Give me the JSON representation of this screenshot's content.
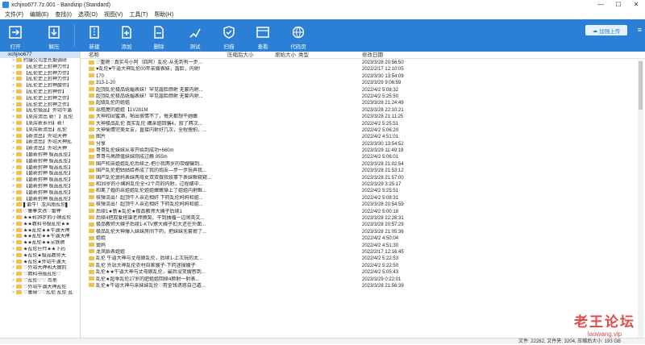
{
  "window": {
    "title": "xchjno677.7z.001 - Bandizip (Standard)",
    "controls": [
      "—",
      "☐",
      "✕"
    ]
  },
  "menu": [
    "文件(F)",
    "编辑(E)",
    "查找(I)",
    "选项(O)",
    "视图(V)",
    "工具(T)",
    "帮助(H)"
  ],
  "toolbar": {
    "open": "打开",
    "extract": "解压",
    "new": "新建",
    "add": "添加",
    "delete": "删除",
    "test": "测试",
    "scan": "扫描",
    "view": "查看",
    "codepage": "代码页",
    "download": "加强上传",
    "accent": "#2b7fd4"
  },
  "tree": {
    "root": "xchjno677",
    "items": [
      "约操公司里长期调研",
      "【乱伦史上封神力作】",
      "【乱伦史上封神力作】",
      "【乱伦史上封神力作】",
      "【乱伦史上封神酸作】",
      "【乱伦史上封神作】",
      "【乱伦史上封神之作】",
      "【乱伦史上封神之作】",
      "【乱伦极品】外站牛逼",
      "【某房流出 新！】乱伦",
      "【某房新系列】新！",
      "【某房新流出】乱伦",
      "【新流出】外站大神",
      "【新流出】外站大神乱",
      "【新流出】外站大神",
      "【最新封神 极品乱伦】",
      "【最新封神 极品乱伦】",
      "【最新封神 极品乱伦】",
      "【最新封神 极品乱伦】",
      "【最新封神 极品乱伦】",
      "【最新封神 极品乱伦】",
      "【最新封神 极品乱伦】",
      "【最新封神 极品乱伦】",
      "▌最牛！龙凤胎乱伦▌",
      "♡重拳女孩♡雷神",
      "★★和39岁的小姨乱伦",
      "★★教科书极乱伦★★",
      "★★乱伦★★牛逼大神",
      "★★乱伦★★牛逼大神",
      "★★乱伦★★宗族牌",
      "★乱伦巨作★★下药",
      "★乱伦★极品教师大",
      "★乱伦★外站牛逼大",
      "♡外站大神和大嫂的",
      "♡教科书级乱伦♡",
      "♡乱伦♡♡ 与亲",
      "♡外站牛逼大神乱伦",
      "♡重磅♡♡乱伦 乱伦 乱"
    ]
  },
  "columns": {
    "name": "名称",
    "compressed": "压缩后大小",
    "original": "原始大小",
    "type": "类型",
    "modified": "修改日期"
  },
  "files": [
    {
      "name": "♡重磅♡真实与小阿（四阿）乱伦-从无到有一步...",
      "date": "2023/3/28 20:56:50"
    },
    {
      "name": "♥乱伦♥牛逼大神乱伦00年亲嫂表妹，露脸，内射!",
      "date": "2022/2/17 12:10:05"
    },
    {
      "name": "170",
      "date": "2023/3/30 13:54:09"
    },
    {
      "name": "313-1-20",
      "date": "2023/3/29 9:06:59"
    },
    {
      "name": "超顶乱伦极品妩媚表妹！罕见露脸颜射 无套内射...",
      "date": "2022/4/2 5:08:32"
    },
    {
      "name": "超顶乱伦极品妩媚表妹！罕见露脸颜射 无套内射...",
      "date": "2022/4/2 5:25:50"
    },
    {
      "name": "超级乱伦的姐姐",
      "date": "2023/3/28 21:24:49"
    },
    {
      "name": "出租屋的姐姐【1V281M",
      "date": "2023/3/28 22:10:21"
    },
    {
      "name": "大神和闺蜜酒，啪出很情不了，每天都想干她嫩",
      "date": "2023/3/28 21:11:25"
    },
    {
      "name": "大神极品乱伦 真实乱伦 媾亲姐回骗4，寂了两次...",
      "date": "2022/4/2 5:25:51"
    },
    {
      "name": "大神偷情完美女友，直接内射好几次，全程撸拍，...",
      "date": "2022/4/2 5:06:20"
    },
    {
      "name": "图片",
      "date": "2022/4/2 4:51:01"
    },
    {
      "name": "分享",
      "date": "2023/3/30 13:54:52"
    },
    {
      "name": "哥哥乱伦妹妹从零开始到成功+660m",
      "date": "2023/3/29 11:49:19"
    },
    {
      "name": "哥哥与高颜值妹妹刚成过瘾 955m",
      "date": "2022/4/2 5:06:01"
    },
    {
      "name": "国产和亲姐姐乱伦后续之-把小我两岁的带嫂骗到...",
      "date": "2023/3/28 21:02:54"
    },
    {
      "name": "国产乱伦把姑姑给养成了我的炮友—步一步玩弄我...",
      "date": "2023/3/28 21:53:12"
    },
    {
      "name": "国产乱伦舅妈表妹两母女双双做我奴事下表妹瞬窥窥...",
      "date": "2023/3/28 21:57:00"
    },
    {
      "name": "和39岁的小姨妈乱伦全+2个月的内射，过程细中...",
      "date": "2023/3/29 3:25:17"
    },
    {
      "name": "和离了婚的亲姐姐乱伦姐姐嫩嫩操上了姐姐内射眶...",
      "date": "2022/4/2 5:25:51"
    },
    {
      "name": "核弹流出！超顶牛人亲近相奸 下药乱伦妈妈和姐...",
      "date": "2022/4/2 5:08:31"
    },
    {
      "name": "核弹流出！超顶牛人亲近相奸 下药乱伦妈妈和姐...",
      "date": "2023/3/28 20:54:59"
    },
    {
      "name": "后续1★新★乱伦★极品教师大姨子后续1",
      "date": "2022/4/2 5:00:18"
    },
    {
      "name": "后续4把双爱搭谱老师撩哭，干到抽搐一边闹英文...",
      "date": "2023/3/28 22:28:31"
    },
    {
      "name": "极品教师大姨子后续1-KTV撩大姨子扣大还在外面...",
      "date": "2023/3/28 20:57:29"
    },
    {
      "name": "极品乱伦大神爆入妹妹房间下药，把妹妹无套摁了...",
      "date": "2023/3/28 21:05:36"
    },
    {
      "name": "姐姐",
      "date": "2022/4/2 4:50:04"
    },
    {
      "name": "舅妈",
      "date": "2022/4/2 4:51:30"
    },
    {
      "name": "龙凤胎表姐姐",
      "date": "2022/2/17 12:16:45"
    },
    {
      "name": "乱伦 牛逼大神与丈母娘乱伦，后续1-上次玩的太...",
      "date": "2022/4/2 5:22:53"
    },
    {
      "name": "乱伦 外站大神乱伦农村自家嫂子-下药迷操嫂子",
      "date": "2022/4/2 5:22:50"
    },
    {
      "name": "乱伦★★牛逼大神与丈母娘乱伦，最后没变嫂感到...",
      "date": "2022/4/2 5:05:43"
    },
    {
      "name": "乱伦★超乖乱伦27岁的肥姐姐回续4颜射一射表...",
      "date": "2023/3/29 0:22:01"
    },
    {
      "name": "乱伦★牛逼大神与亲妹妹乱伦♡用金钱诱惑自己遁...",
      "date": "2023/3/28 21:56:39"
    }
  ],
  "status": {
    "text": "文件: 22282, 文件夹: 3204, 压缩后大小: 193 GB"
  },
  "watermark": {
    "line1": "老王论坛",
    "line2": "laowang.vip"
  }
}
